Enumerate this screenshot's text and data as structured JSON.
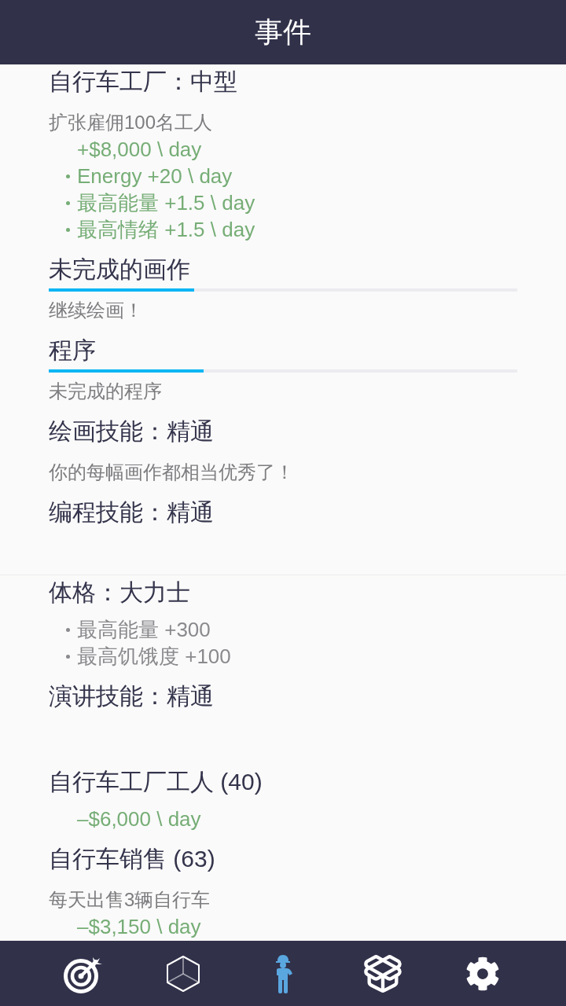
{
  "header": {
    "title": "事件"
  },
  "groups": [
    {
      "events": [
        {
          "title": "自行车工厂：中型",
          "description": "扩张雇佣100名工人",
          "effects": [
            {
              "kind": "amount",
              "text": "+$8,000 \\ day"
            },
            {
              "kind": "rate",
              "text": "Energy +20 \\ day"
            },
            {
              "kind": "rate",
              "text": "最高能量 +1.5 \\ day"
            },
            {
              "kind": "rate",
              "text": "最高情绪 +1.5 \\ day"
            }
          ]
        },
        {
          "title": "未完成的画作",
          "level": 0.31,
          "description": "继续绘画！"
        },
        {
          "title": "程序",
          "level": 0.33,
          "description": "未完成的程序"
        },
        {
          "title": "绘画技能：精通",
          "description": "你的每幅画作都相当优秀了！"
        },
        {
          "title": "编程技能：精通"
        }
      ]
    },
    {
      "events": [
        {
          "title": "体格：大力士",
          "effects": [
            {
              "kind": "bonus",
              "text": "最高能量 +300"
            },
            {
              "kind": "bonus",
              "text": "最高饥饿度 +100"
            }
          ]
        },
        {
          "title": "演讲技能：精通"
        },
        {
          "title": "自行车工厂工人 (40)",
          "effects": [
            {
              "kind": "amount",
              "text": "–$6,000 \\ day"
            }
          ]
        },
        {
          "title": "自行车销售 (63)",
          "description": "每天出售3辆自行车",
          "effects": [
            {
              "kind": "amount",
              "text": "–$3,150 \\ day"
            }
          ]
        }
      ]
    }
  ],
  "nav": [
    {
      "kind": "target",
      "selected": false
    },
    {
      "kind": "cube",
      "selected": false
    },
    {
      "kind": "worker",
      "selected": true
    },
    {
      "kind": "box",
      "selected": false
    },
    {
      "kind": "settings",
      "selected": false
    }
  ]
}
